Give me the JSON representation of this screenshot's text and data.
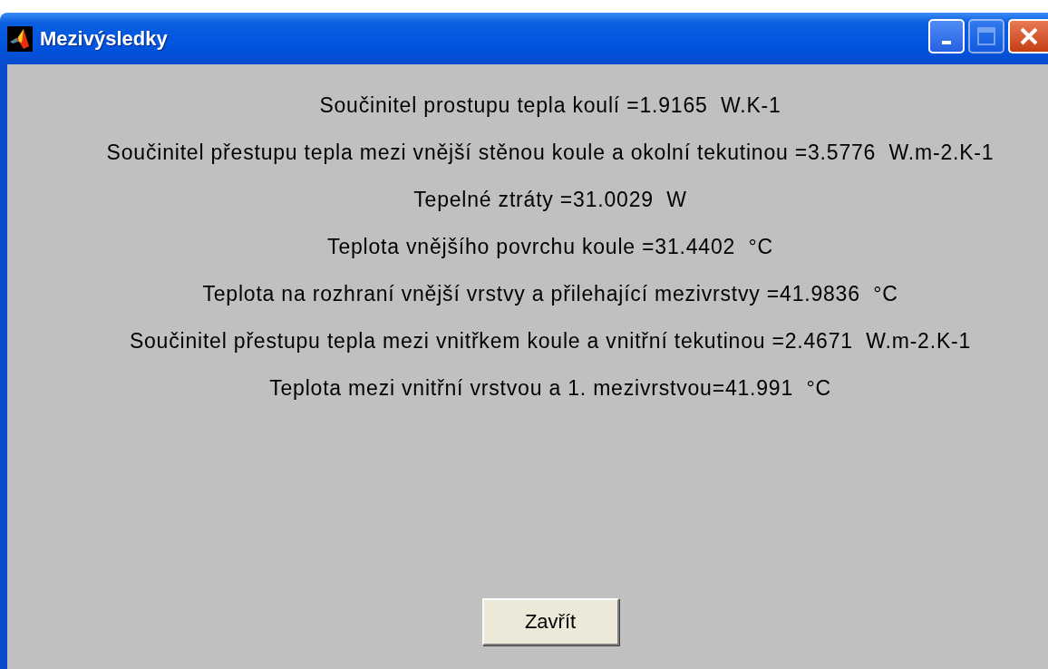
{
  "window": {
    "title": "Mezivýsledky"
  },
  "results": [
    {
      "text": "Součinitel prostupu tepla koulí =1.9165  W.K-1"
    },
    {
      "text": "Součinitel přestupu tepla mezi vnější stěnou koule a okolní tekutinou =3.5776  W.m-2.K-1"
    },
    {
      "text": "Tepelné ztráty =31.0029  W"
    },
    {
      "text": "Teplota vnějšího povrchu koule =31.4402  °C"
    },
    {
      "text": "Teplota na rozhraní vnější vrstvy a přilehající mezivrstvy =41.9836  °C"
    },
    {
      "text": "Součinitel přestupu tepla mezi vnitřkem koule a vnitřní tekutinou =2.4671  W.m-2.K-1"
    },
    {
      "text": "Teplota mezi vnitřní vrstvou a 1. mezivrstvou=41.991  °C"
    }
  ],
  "buttons": [
    "Zavřít"
  ]
}
